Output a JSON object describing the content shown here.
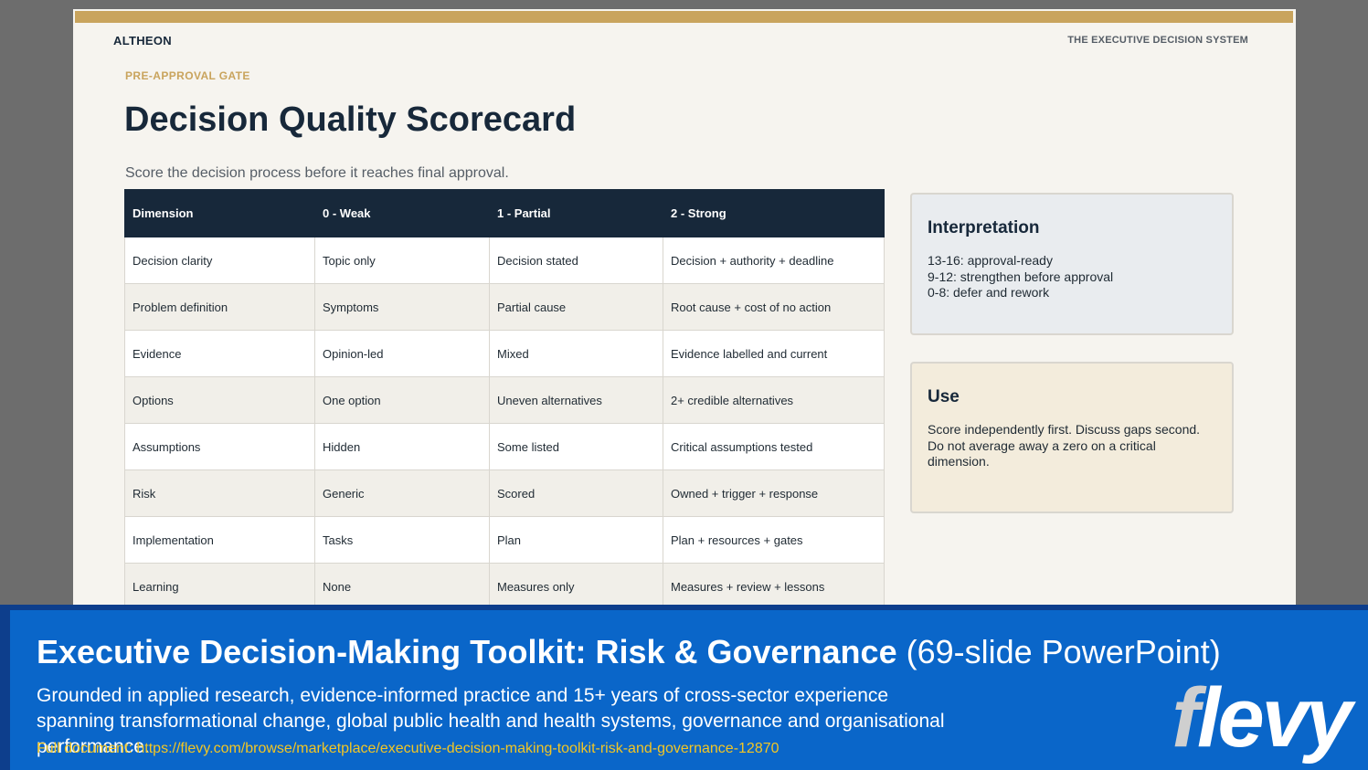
{
  "slide": {
    "brand": "ALTHEON",
    "tagline": "THE EXECUTIVE DECISION SYSTEM",
    "eyebrow": "PRE-APPROVAL GATE",
    "title": "Decision Quality Scorecard",
    "subtitle": "Score the decision process before it reaches final approval.",
    "table": {
      "headers": [
        "Dimension",
        "0 - Weak",
        "1 - Partial",
        "2 - Strong"
      ],
      "rows": [
        [
          "Decision clarity",
          "Topic only",
          "Decision stated",
          "Decision + authority + deadline"
        ],
        [
          "Problem definition",
          "Symptoms",
          "Partial cause",
          "Root cause + cost of no action"
        ],
        [
          "Evidence",
          "Opinion-led",
          "Mixed",
          "Evidence labelled and current"
        ],
        [
          "Options",
          "One option",
          "Uneven alternatives",
          "2+ credible alternatives"
        ],
        [
          "Assumptions",
          "Hidden",
          "Some listed",
          "Critical assumptions tested"
        ],
        [
          "Risk",
          "Generic",
          "Scored",
          "Owned + trigger + response"
        ],
        [
          "Implementation",
          "Tasks",
          "Plan",
          "Plan + resources + gates"
        ],
        [
          "Learning",
          "None",
          "Measures only",
          "Measures + review + lessons"
        ]
      ]
    },
    "interpretation": {
      "title": "Interpretation",
      "lines": [
        "13-16: approval-ready",
        "9-12: strengthen before approval",
        "0-8: defer and rework"
      ]
    },
    "use": {
      "title": "Use",
      "text": "Score independently first. Discuss gaps second. Do not average away a zero on a critical dimension."
    }
  },
  "banner": {
    "title_bold": "Executive Decision-Making Toolkit: Risk & Governance",
    "title_rest": " (69-slide PowerPoint)",
    "description": "Grounded in applied research, evidence-informed practice and 15+ years of cross-sector experience spanning transformational change, global public health and health systems, governance and organisational performance.",
    "link": "Full document: https://flevy.com/browse/marketplace/executive-decision-making-toolkit-risk-and-governance-12870",
    "logo": "flevy"
  },
  "colors": {
    "navy": "#17283a",
    "gold": "#c9a45d",
    "banner_blue": "#0a66c9",
    "link_yellow": "#f3c623"
  }
}
